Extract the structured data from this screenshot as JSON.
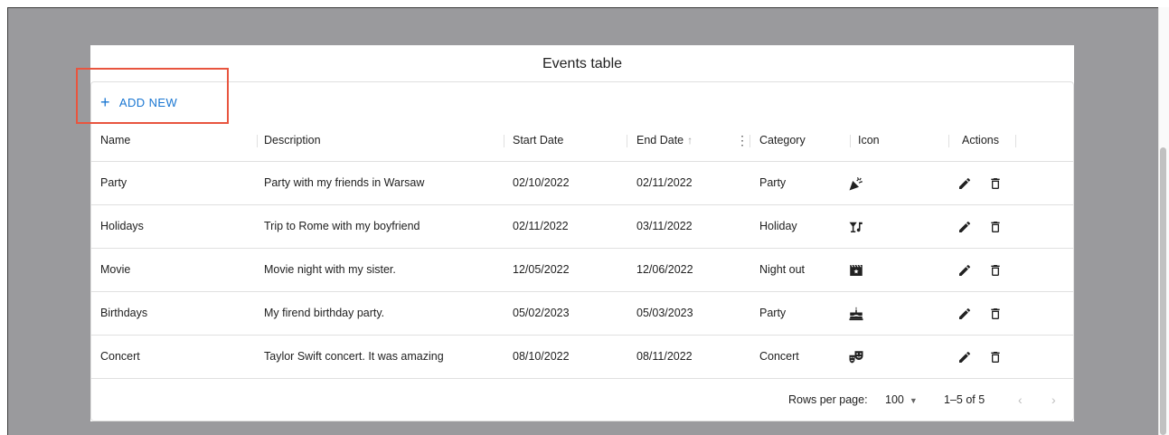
{
  "dialog": {
    "title": "Events table"
  },
  "toolbar": {
    "add_label": "ADD NEW"
  },
  "columns": [
    {
      "key": "name",
      "label": "Name"
    },
    {
      "key": "description",
      "label": "Description"
    },
    {
      "key": "start",
      "label": "Start Date"
    },
    {
      "key": "end",
      "label": "End Date"
    },
    {
      "key": "category",
      "label": "Category"
    },
    {
      "key": "icon",
      "label": "Icon"
    },
    {
      "key": "actions",
      "label": "Actions"
    }
  ],
  "sort": {
    "column": "end",
    "direction": "ascending"
  },
  "rows": [
    {
      "name": "Party",
      "description": "Party with my friends in Warsaw",
      "start": "02/10/2022",
      "end": "02/11/2022",
      "category": "Party",
      "icon": "party-popper-icon"
    },
    {
      "name": "Holidays",
      "description": "Trip to Rome with my boyfriend",
      "start": "02/11/2022",
      "end": "03/11/2022",
      "category": "Holiday",
      "icon": "nightlife-icon"
    },
    {
      "name": "Movie",
      "description": "Movie night with my sister.",
      "start": "12/05/2022",
      "end": "12/06/2022",
      "category": "Night out",
      "icon": "movie-clapper-icon"
    },
    {
      "name": "Birthdays",
      "description": "My firend birthday party.",
      "start": "05/02/2023",
      "end": "05/03/2023",
      "category": "Party",
      "icon": "birthday-cake-icon"
    },
    {
      "name": "Concert",
      "description": "Taylor Swift concert. It was amazing",
      "start": "08/10/2022",
      "end": "08/11/2022",
      "category": "Concert",
      "icon": "theater-masks-icon"
    }
  ],
  "footer": {
    "rows_per_page_label": "Rows per page:",
    "rows_per_page_value": "100",
    "range": "1–5 of 5"
  },
  "colors": {
    "accent": "#1976d2",
    "highlight": "#e8553f",
    "backdrop": "#9a9a9d"
  }
}
